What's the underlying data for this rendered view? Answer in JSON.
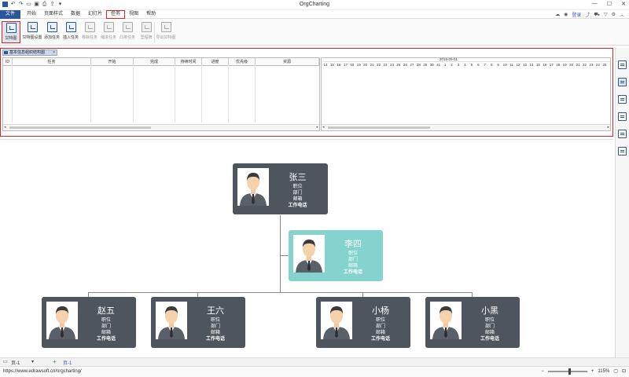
{
  "window": {
    "title": "OrgCharting",
    "quick_access_icons": [
      "app-icon",
      "undo-icon",
      "redo-icon",
      "open-icon",
      "save-icon",
      "print-icon",
      "export-icon",
      "more-icon"
    ]
  },
  "menu": {
    "items": [
      "文件",
      "开始",
      "页面样式",
      "数据",
      "幻灯片",
      "任务",
      "视图",
      "帮助"
    ],
    "active_index": 5,
    "login_label": "登录"
  },
  "ribbon": {
    "buttons": [
      {
        "label": "甘特图",
        "enabled": true,
        "selected": true
      },
      {
        "label": "甘特图设置",
        "enabled": true,
        "selected": false
      },
      {
        "label": "添加任务",
        "enabled": true,
        "selected": false
      },
      {
        "label": "插入任务",
        "enabled": true,
        "selected": false
      },
      {
        "label": "移除任务",
        "enabled": false,
        "selected": false
      },
      {
        "label": "缩进任务",
        "enabled": false,
        "selected": false
      },
      {
        "label": "凸排任务",
        "enabled": false,
        "selected": false
      },
      {
        "label": "里程碑",
        "enabled": false,
        "selected": false
      },
      {
        "label": "导出甘特图",
        "enabled": false,
        "selected": false
      }
    ]
  },
  "gantt": {
    "tab_label": "基本信息组织结构图",
    "columns": [
      "ID",
      "任务",
      "开始",
      "完成",
      "持续时间",
      "进度",
      "优先级",
      "资源"
    ],
    "month_label": "2016-09-01",
    "days": [
      "14",
      "15",
      "16",
      "17",
      "18",
      "19",
      "20",
      "21",
      "22",
      "23",
      "24",
      "25",
      "26",
      "27",
      "28",
      "29",
      "30",
      "31",
      "1",
      "2",
      "3",
      "4",
      "5",
      "6",
      "7",
      "8",
      "9",
      "10",
      "11",
      "12",
      "13",
      "14",
      "15",
      "16",
      "17",
      "18",
      "19",
      "20",
      "21",
      "22",
      "23",
      "24",
      "25"
    ],
    "scroll_left": "◂",
    "scroll_right": "▸"
  },
  "org": {
    "field_lines": [
      "职位",
      "部门",
      "邮箱",
      "工作电话"
    ],
    "root": {
      "name": "张三"
    },
    "assistant": {
      "name": "李四"
    },
    "children": [
      {
        "name": "赵五"
      },
      {
        "name": "王六"
      },
      {
        "name": "小杨"
      },
      {
        "name": "小黑"
      }
    ],
    "colors": {
      "dark": "#4e555c",
      "teal": "#85d3ce",
      "file_menu": "#2b579a",
      "highlight": "#dd2222"
    }
  },
  "pagebar": {
    "page1": "页-1",
    "add": "+",
    "page2": "页-1"
  },
  "status": {
    "url": "https://www.edrawsoft.cn/orgcharting/",
    "zoom_minus": "−",
    "zoom_plus": "+",
    "zoom": "115%",
    "zoom_fraction": 0.55
  }
}
